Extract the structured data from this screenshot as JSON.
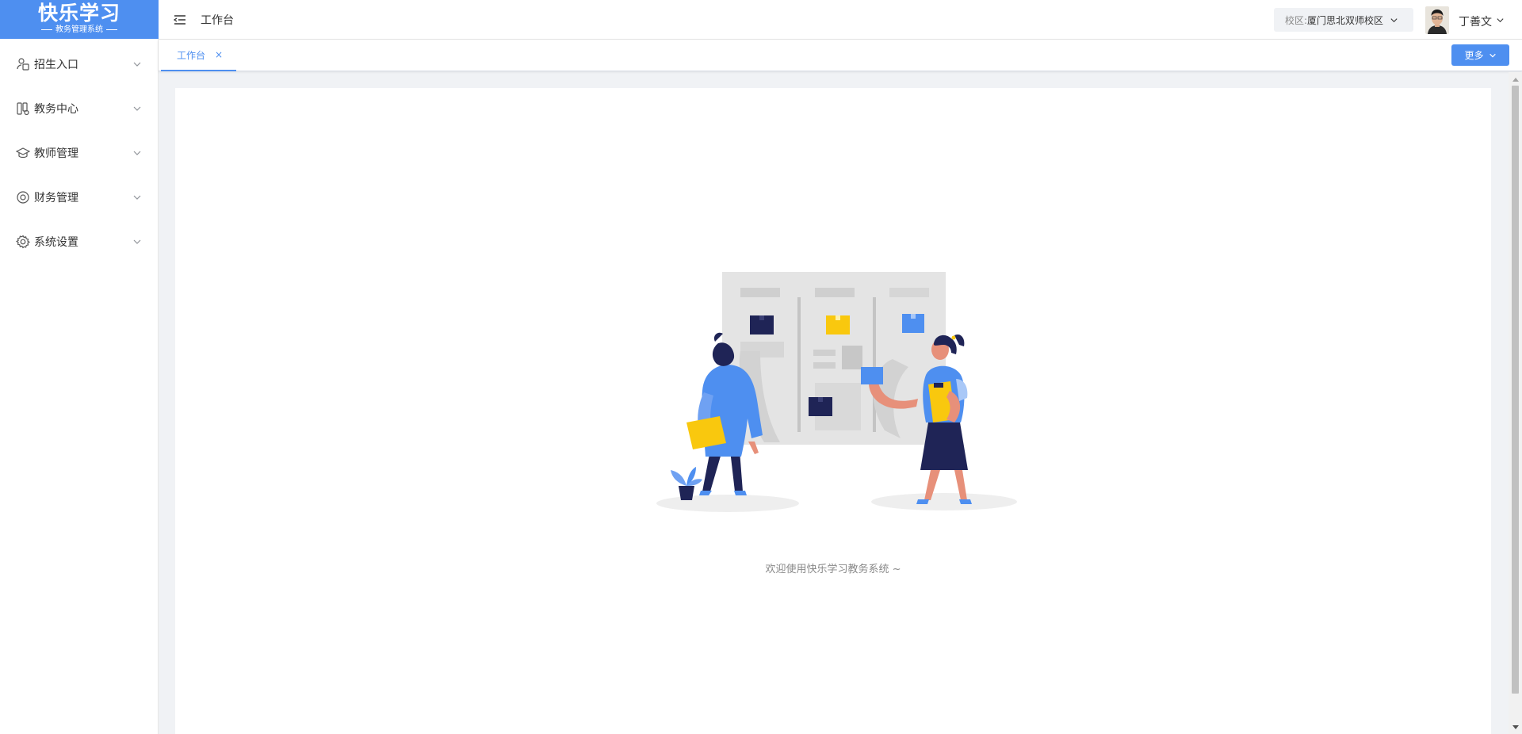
{
  "logo": {
    "title": "快乐学习",
    "subtitle": "教务管理系统"
  },
  "sidebar": {
    "items": [
      {
        "label": "招生入口",
        "icon": "enrollment-icon"
      },
      {
        "label": "教务中心",
        "icon": "academic-icon"
      },
      {
        "label": "教师管理",
        "icon": "graduation-cap-icon"
      },
      {
        "label": "财务管理",
        "icon": "finance-icon"
      },
      {
        "label": "系统设置",
        "icon": "gear-icon"
      }
    ]
  },
  "header": {
    "title": "工作台",
    "campus_label": "校区:",
    "campus_value": "厦门思北双师校区",
    "username": "丁善文"
  },
  "tabs": [
    {
      "label": "工作台",
      "close": "×"
    }
  ],
  "more_button": "更多",
  "main": {
    "welcome": "欢迎使用快乐学习教务系统 ~"
  },
  "colors": {
    "accent": "#4e8ff0",
    "navy": "#1f2456",
    "yellow": "#f9c80e"
  }
}
